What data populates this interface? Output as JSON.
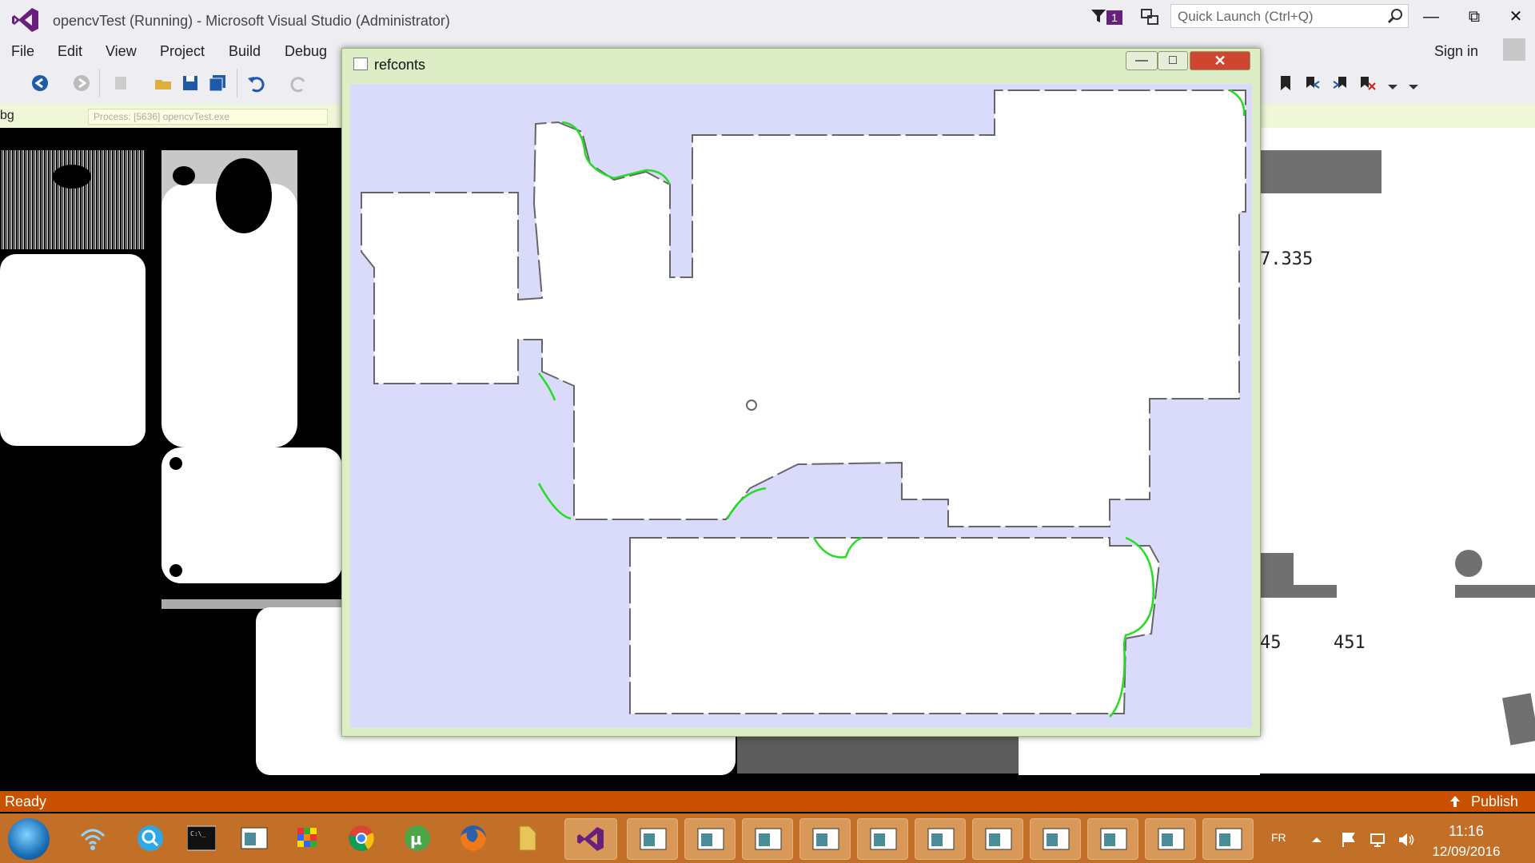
{
  "vs": {
    "title": "opencvTest (Running) - Microsoft Visual Studio (Administrator)",
    "notification_count": "1",
    "quick_launch_placeholder": "Quick Launch (Ctrl+Q)",
    "menu": [
      "File",
      "Edit",
      "View",
      "Project",
      "Build",
      "Debug"
    ],
    "sign_in": "Sign in",
    "debug_label": "bg",
    "process_label": "Process: [5636] opencvTest.exe",
    "status": "Ready",
    "publish": "Publish",
    "accent": "#68217a",
    "statusbar_color": "#ca5100"
  },
  "background_window": {
    "text_1": "7.335",
    "text_2": "45",
    "text_3": "451"
  },
  "refconts": {
    "title": "refconts",
    "canvas_bg": "#dadafa",
    "contour_color": "#22dd22"
  },
  "taskbar": {
    "apps": [
      "start",
      "network",
      "search",
      "cmd",
      "window",
      "rubik",
      "chrome",
      "utorrent",
      "firefox",
      "folder",
      "visual-studio",
      "window",
      "window",
      "window",
      "window",
      "window",
      "window",
      "window",
      "window",
      "window",
      "window",
      "window"
    ],
    "lang": "FR",
    "time": "11:16",
    "date": "12/09/2016"
  }
}
